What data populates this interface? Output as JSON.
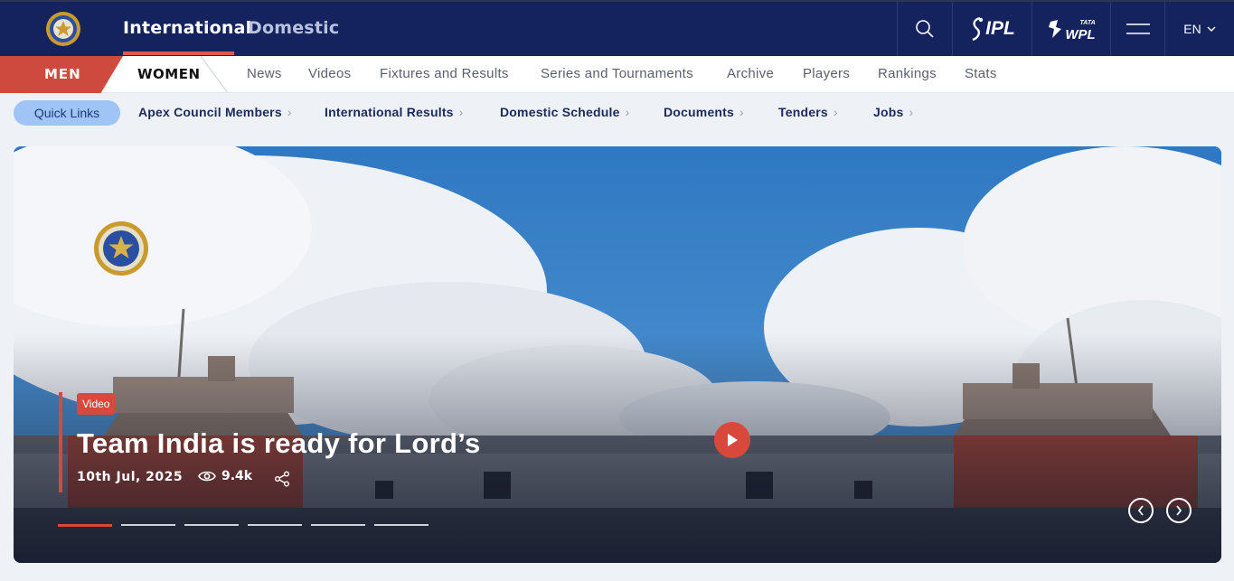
{
  "header": {
    "tabs": [
      {
        "label": "International",
        "active": true
      },
      {
        "label": "Domestic",
        "active": false
      }
    ],
    "ipl_label": "IPL",
    "wpl_brand": "TATA",
    "wpl_label": "WPL",
    "language": "EN"
  },
  "gender_tabs": {
    "men": "MEN",
    "women": "WOMEN",
    "active": "MEN"
  },
  "nav": {
    "items": [
      "News",
      "Videos",
      "Fixtures and Results",
      "Series and Tournaments",
      "Archive",
      "Players",
      "Rankings",
      "Stats"
    ]
  },
  "quick_links": {
    "label": "Quick Links",
    "items": [
      "Apex Council Members",
      "International Results",
      "Domestic Schedule",
      "Documents",
      "Tenders",
      "Jobs"
    ]
  },
  "hero": {
    "badge": "Video",
    "title": "Team India is ready for Lord’s",
    "date": "10th Jul, 2025",
    "views": "9.4k",
    "slide_count": 6,
    "active_slide": 1
  },
  "colors": {
    "header_bg": "#14235e",
    "accent": "#d9493b",
    "quick_pill": "#9fc4f5"
  }
}
